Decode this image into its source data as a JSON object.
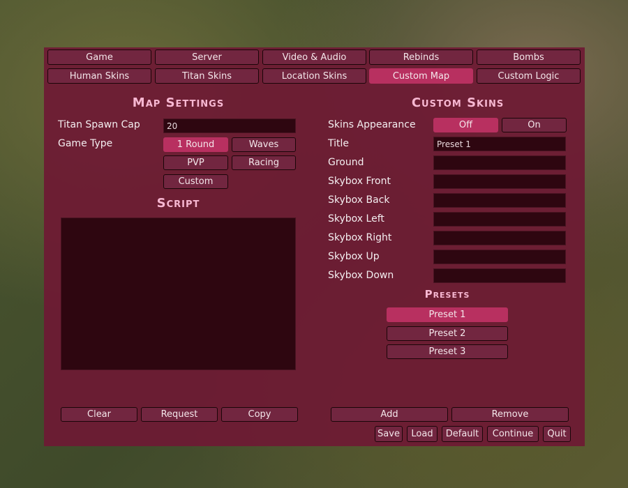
{
  "tabs_row1": [
    "Game",
    "Server",
    "Video & Audio",
    "Rebinds",
    "Bombs"
  ],
  "tabs_row2": [
    "Human Skins",
    "Titan Skins",
    "Location Skins",
    "Custom Map",
    "Custom Logic"
  ],
  "active_tab": "Custom Map",
  "map_settings": {
    "heading": "Map Settings",
    "titan_spawn_cap_label": "Titan Spawn Cap",
    "titan_spawn_cap_value": "20",
    "game_type_label": "Game Type",
    "game_types": [
      "1 Round",
      "Waves",
      "PVP",
      "Racing",
      "Custom"
    ],
    "selected_game_type": "1 Round"
  },
  "script": {
    "heading": "Script",
    "value": "",
    "buttons": [
      "Clear",
      "Request",
      "Copy"
    ]
  },
  "custom_skins": {
    "heading": "Custom Skins",
    "appearance_label": "Skins Appearance",
    "appearance_options": [
      "Off",
      "On"
    ],
    "appearance_selected": "Off",
    "fields": [
      {
        "label": "Title",
        "value": "Preset 1"
      },
      {
        "label": "Ground",
        "value": ""
      },
      {
        "label": "Skybox Front",
        "value": ""
      },
      {
        "label": "Skybox Back",
        "value": ""
      },
      {
        "label": "Skybox Left",
        "value": ""
      },
      {
        "label": "Skybox Right",
        "value": ""
      },
      {
        "label": "Skybox Up",
        "value": ""
      },
      {
        "label": "Skybox Down",
        "value": ""
      }
    ]
  },
  "presets": {
    "heading": "Presets",
    "items": [
      "Preset 1",
      "Preset 2",
      "Preset 3"
    ],
    "selected": "Preset 1",
    "add": "Add",
    "remove": "Remove"
  },
  "footer": [
    "Save",
    "Load",
    "Default",
    "Continue",
    "Quit"
  ],
  "colors": {
    "panel": "#6e1a34",
    "button": "#722640",
    "active": "#b83060",
    "input": "#2e0610",
    "heading": "#f7b8d2"
  }
}
